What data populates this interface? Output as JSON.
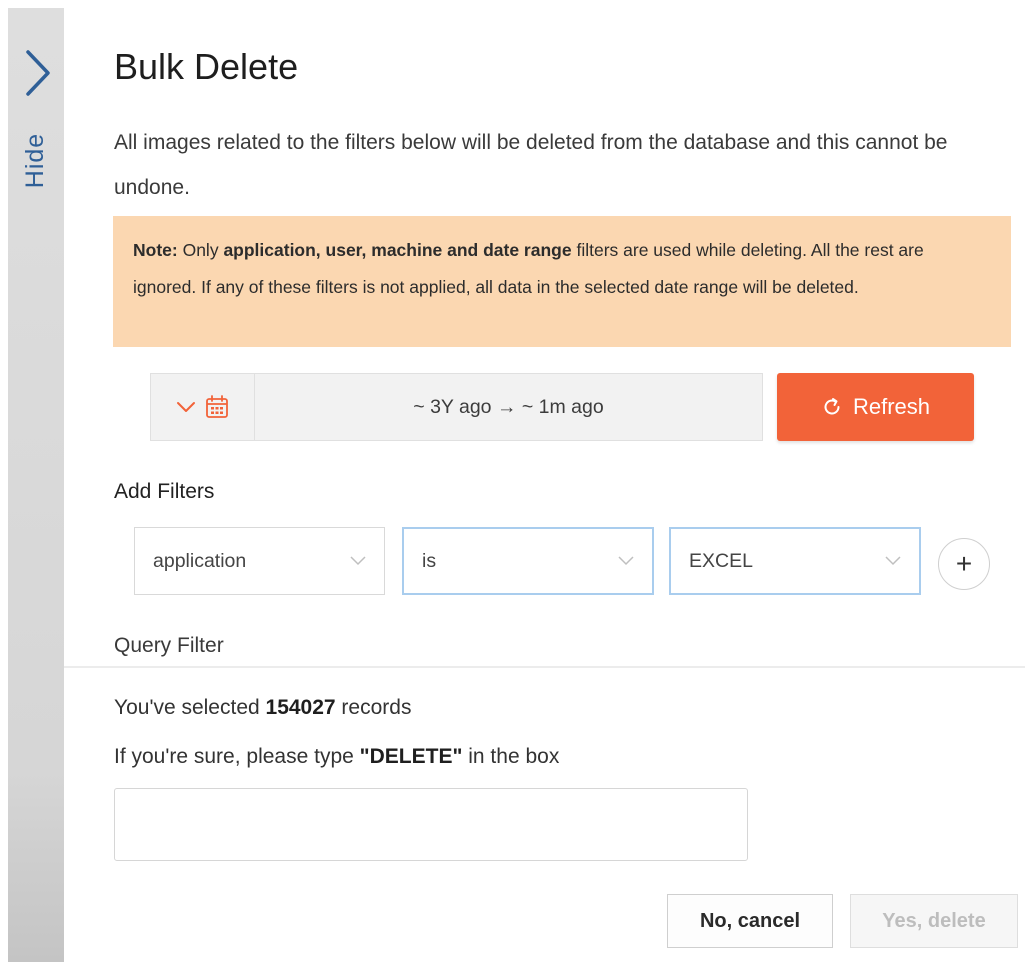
{
  "sidebar": {
    "hide_label": "Hide"
  },
  "dialog": {
    "title": "Bulk Delete",
    "description": "All images related to the filters below will be deleted from the database and this cannot be undone."
  },
  "note": {
    "prefix": "Note:",
    "text_before": " Only ",
    "emphasis": "application, user, machine and date range",
    "text_after": " filters are used while deleting. All the rest are ignored. If any of these filters is not applied, all data in the selected date range will be deleted."
  },
  "date_range": {
    "label": "~ 3Y ago  →  ~ 1m ago"
  },
  "refresh_button": {
    "label": "Refresh"
  },
  "filters": {
    "heading": "Add Filters",
    "field": "application",
    "operator": "is",
    "value": "EXCEL",
    "add_label": "+"
  },
  "query_filter": {
    "label": "Query Filter"
  },
  "selection": {
    "prefix": "You've selected ",
    "count": "154027",
    "suffix": " records"
  },
  "confirm": {
    "prefix": "If you're sure, please type ",
    "keyword": "\"DELETE\"",
    "suffix": " in the box",
    "input_value": "",
    "input_placeholder": ""
  },
  "buttons": {
    "cancel": "No, cancel",
    "delete": "Yes, delete"
  },
  "colors": {
    "accent": "#f26339",
    "note_background": "#fbd7b1",
    "hide_text": "#2f5f97",
    "active_select_border": "#a9cdee",
    "sidebar_strip": "#d6d6d6"
  }
}
